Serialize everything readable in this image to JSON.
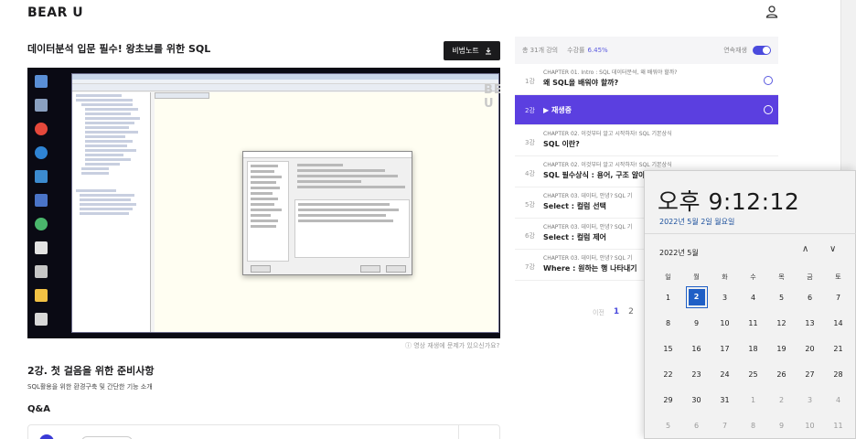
{
  "header": {
    "logo": "BEAR U"
  },
  "lecture": {
    "title": "데이터분석 입문 필수! 왕초보를 위한 SQL",
    "note_button": "비법노트",
    "note_icon": "download-icon"
  },
  "video": {
    "watermark": "BEAR U",
    "caption": "ⓘ 영상 재생에 문제가 있으신가요?"
  },
  "section": {
    "title": "2강. 첫 걸음을 위한 준비사항",
    "desc": "SQL활용을 위한 환경구축 및 간단한 기능 소개"
  },
  "qa": {
    "title": "Q&A"
  },
  "panel": {
    "total": "총 31개 강의",
    "progress_label": "수강률",
    "progress_value": "6.45%",
    "autoplay": "연속재생",
    "accent": "#5b3fe0",
    "chapters": [
      {
        "num": "1강",
        "sub": "CHAPTER 01. Intro : SQL 데이터분석, 왜 배워야 할까?",
        "name": "왜 SQL을 배워야 할까?"
      },
      {
        "num": "2강",
        "sub": "",
        "name": "▶ 재생중"
      },
      {
        "num": "3강",
        "sub": "CHAPTER 02. 이것부터 알고 시작하자! SQL 기본상식",
        "name": "SQL 이란?"
      },
      {
        "num": "4강",
        "sub": "CHAPTER 02. 이것부터 알고 시작하자! SQL 기본상식",
        "name": "SQL 필수상식 : 용어, 구조 알아"
      },
      {
        "num": "5강",
        "sub": "CHAPTER 03. 데이터, 안녕? SQL 기",
        "name": "Select : 컬럼 선택"
      },
      {
        "num": "6강",
        "sub": "CHAPTER 03. 데이터, 안녕? SQL 기",
        "name": "Select : 컬럼 제어"
      },
      {
        "num": "7강",
        "sub": "CHAPTER 03. 데이터, 안녕? SQL 기",
        "name": "Where : 원하는 행 나타내기"
      }
    ],
    "pager": {
      "prev": "이전",
      "pages": [
        "1",
        "2"
      ]
    }
  },
  "calendar": {
    "time": "오후 9:12:12",
    "date": "2022년 5월 2일 월요일",
    "month": "2022년 5월",
    "weekdays": [
      "일",
      "월",
      "화",
      "수",
      "목",
      "금",
      "토"
    ],
    "days": [
      "1",
      "2",
      "3",
      "4",
      "5",
      "6",
      "7",
      "8",
      "9",
      "10",
      "11",
      "12",
      "13",
      "14",
      "15",
      "16",
      "17",
      "18",
      "19",
      "20",
      "21",
      "22",
      "23",
      "24",
      "25",
      "26",
      "27",
      "28",
      "29",
      "30",
      "31",
      "1",
      "2",
      "3",
      "4",
      "5",
      "6",
      "7",
      "8",
      "9",
      "10",
      "11"
    ],
    "today_index": 1,
    "other_month_from": 31,
    "today_color": "#1f5fc6"
  }
}
